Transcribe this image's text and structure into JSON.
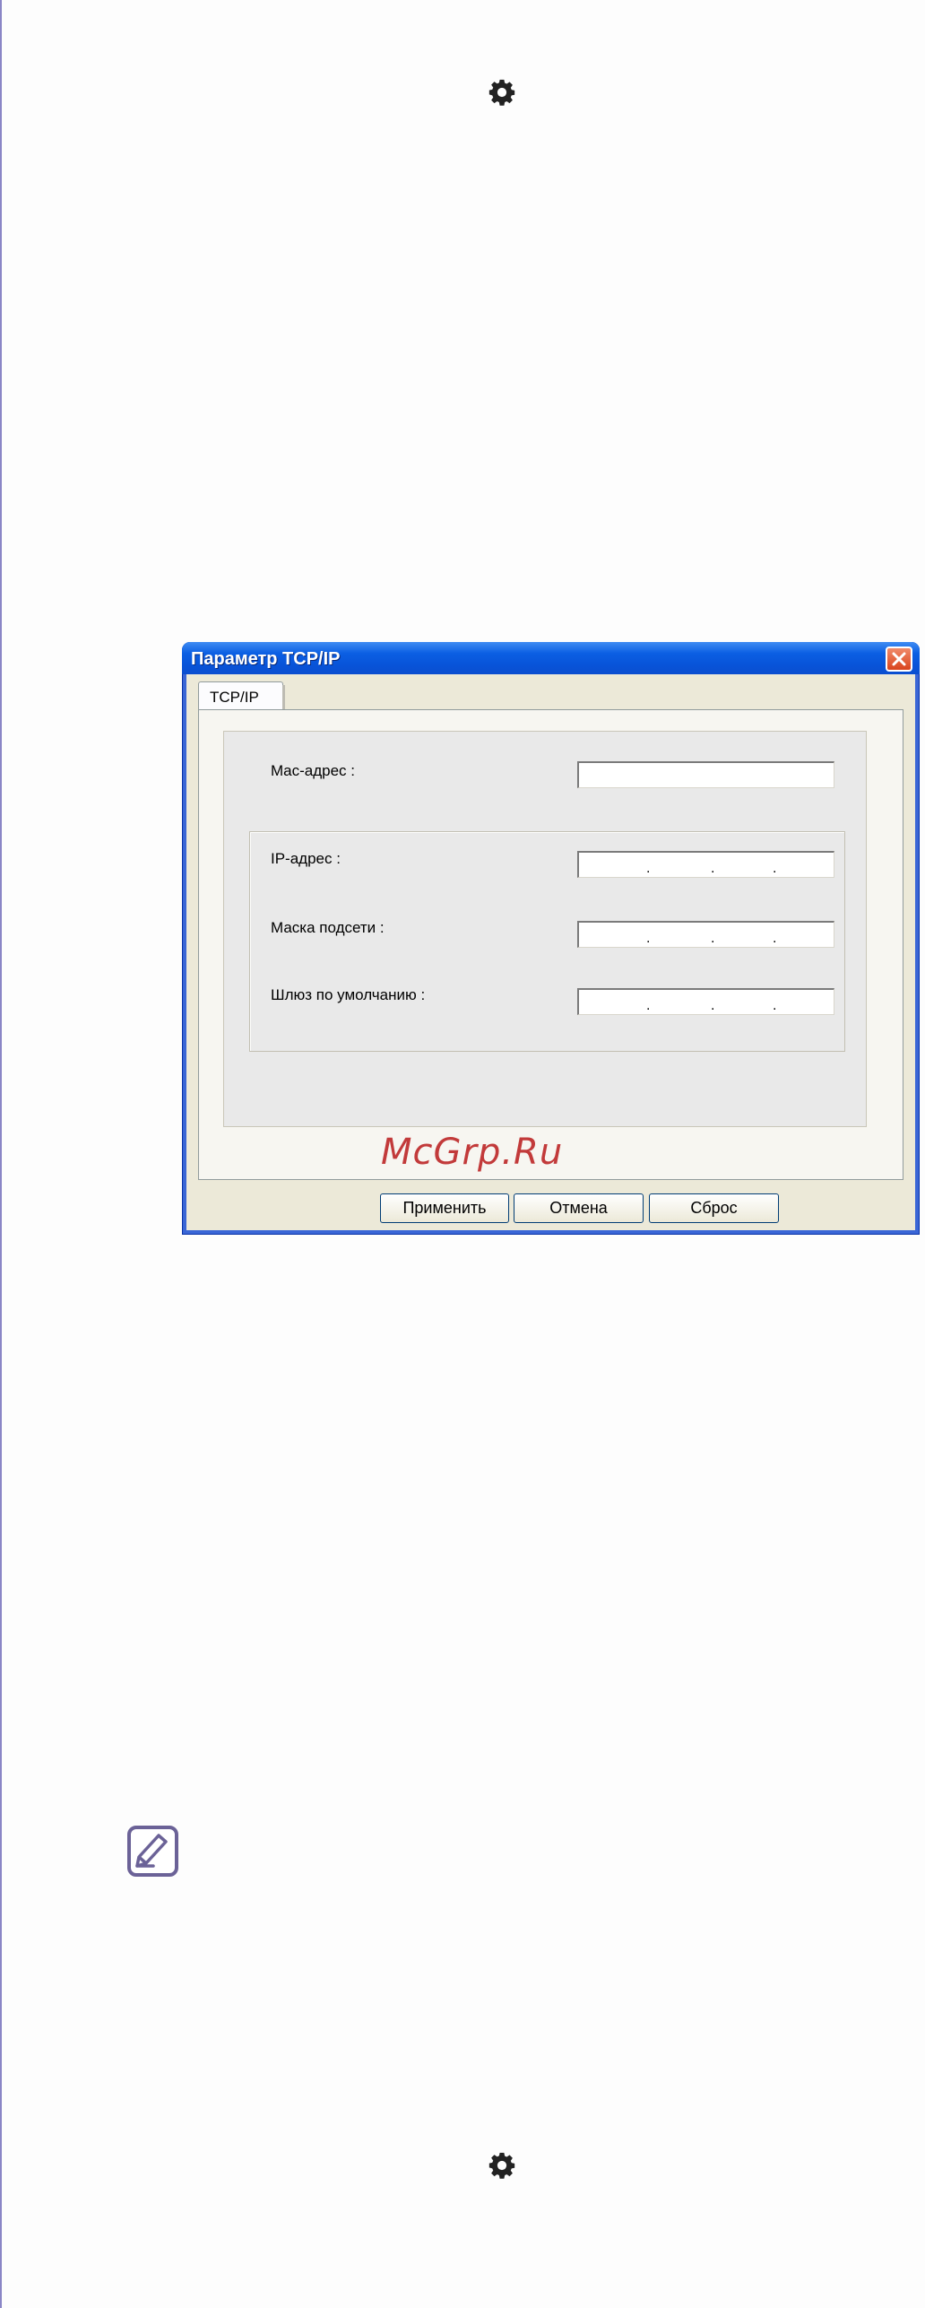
{
  "dialog": {
    "title": "Параметр TCP/IP",
    "tab_label": "TCP/IP",
    "mac_label": "Mac-адрес :",
    "mac_value": "",
    "ip_label": "IP-адрес :",
    "mask_label": "Маска подсети :",
    "gateway_label": "Шлюз по умолчанию :",
    "ip_separator": ".",
    "buttons": {
      "apply": "Применить",
      "cancel": "Отмена",
      "reset": "Сброс"
    }
  },
  "watermark": "McGrp.Ru",
  "icons": {
    "top_gear": "gear-icon",
    "bottom_gear": "gear-icon",
    "note": "note-pencil-icon",
    "close": "close-icon"
  },
  "colors": {
    "titlebar": "#0a5fe3",
    "dialog_bg": "#ece9d8",
    "close_button": "#d9441d",
    "watermark": "#c23a3a",
    "note_icon": "#6b6297",
    "page_rule": "#8a86c6"
  }
}
